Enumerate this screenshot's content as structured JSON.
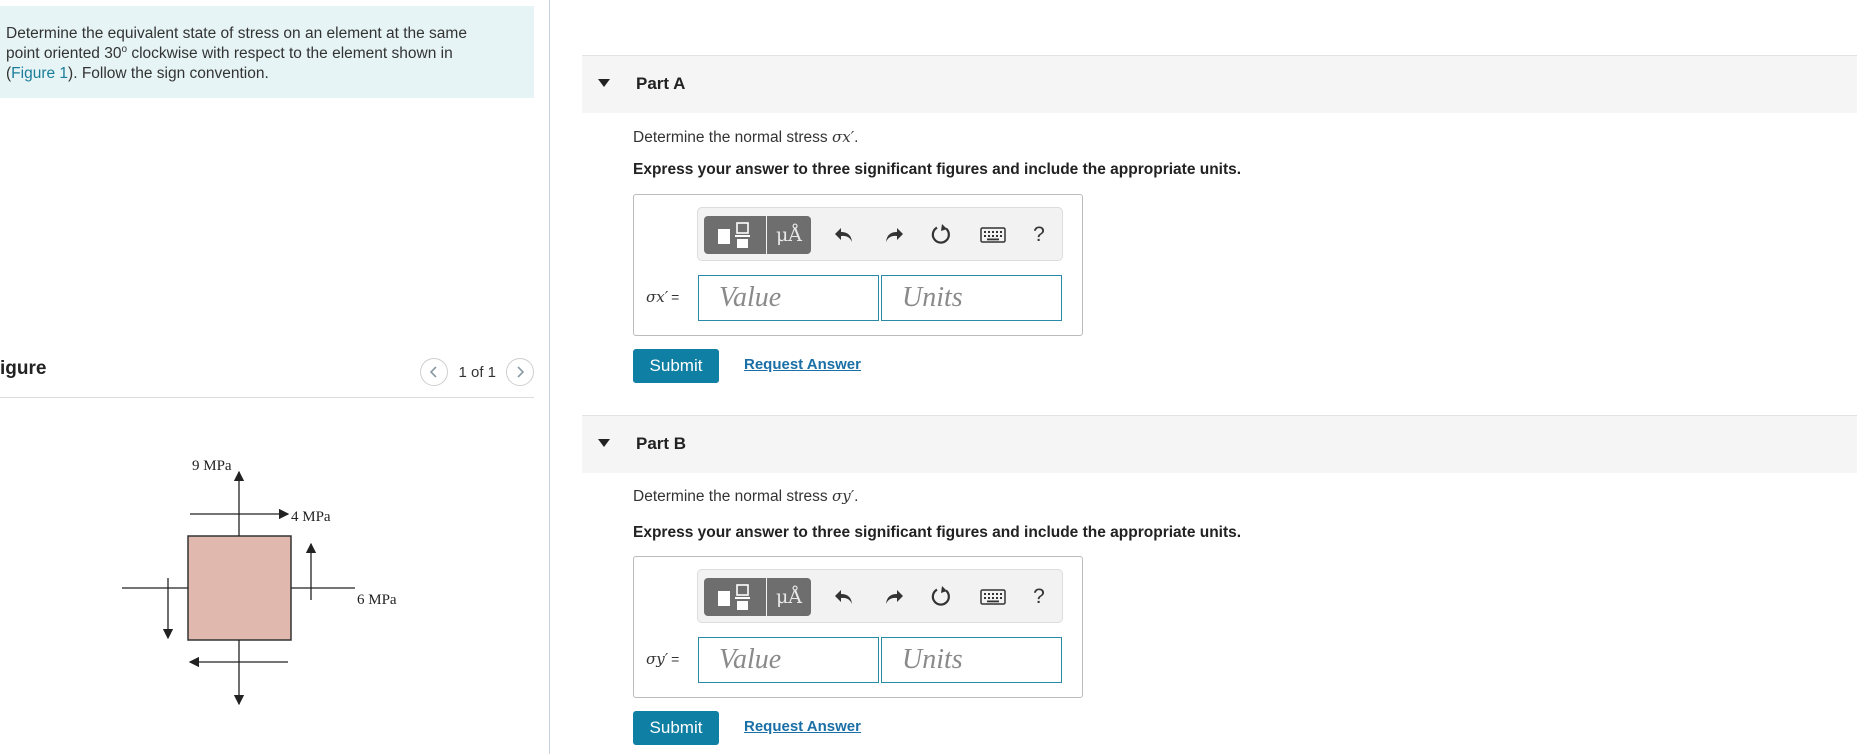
{
  "prompt": {
    "line1": "Determine the equivalent state of stress on an element at the same",
    "line2_pre": "point oriented 30",
    "line2_sup": "o",
    "line2_post": " clockwise with respect to the element shown in",
    "paren_open": "(",
    "figure_link": "Figure 1",
    "line3_post": "). Follow the sign convention."
  },
  "figure_panel": {
    "title": "igure",
    "pager": "1 of 1"
  },
  "figure_labels": {
    "top": "9 MPa",
    "shear": "4 MPa",
    "right": "6 MPa"
  },
  "parts": [
    {
      "title": "Part A",
      "question_pre": "Determine the normal stress ",
      "question_symbol": "σx′",
      "question_post": ".",
      "instruction": "Express your answer to three significant figures and include the appropriate units.",
      "eq_symbol": "σx′",
      "eq_sign": "=",
      "value_placeholder": "Value",
      "units_placeholder": "Units",
      "submit": "Submit",
      "request": "Request Answer"
    },
    {
      "title": "Part B",
      "question_pre": "Determine the normal stress ",
      "question_symbol": "σy′",
      "question_post": ".",
      "instruction": "Express your answer to three significant figures and include the appropriate units.",
      "eq_symbol": "σy′",
      "eq_sign": "=",
      "value_placeholder": "Value",
      "units_placeholder": "Units",
      "submit": "Submit",
      "request": "Request Answer"
    }
  ],
  "toolbar": {
    "mu_label": "μÅ",
    "help_label": "?"
  },
  "colors": {
    "prompt_bg": "#e6f4f5",
    "element_fill": "#e0b8ae",
    "accent": "#0f7fa3",
    "input_border": "#2a8ba8"
  }
}
